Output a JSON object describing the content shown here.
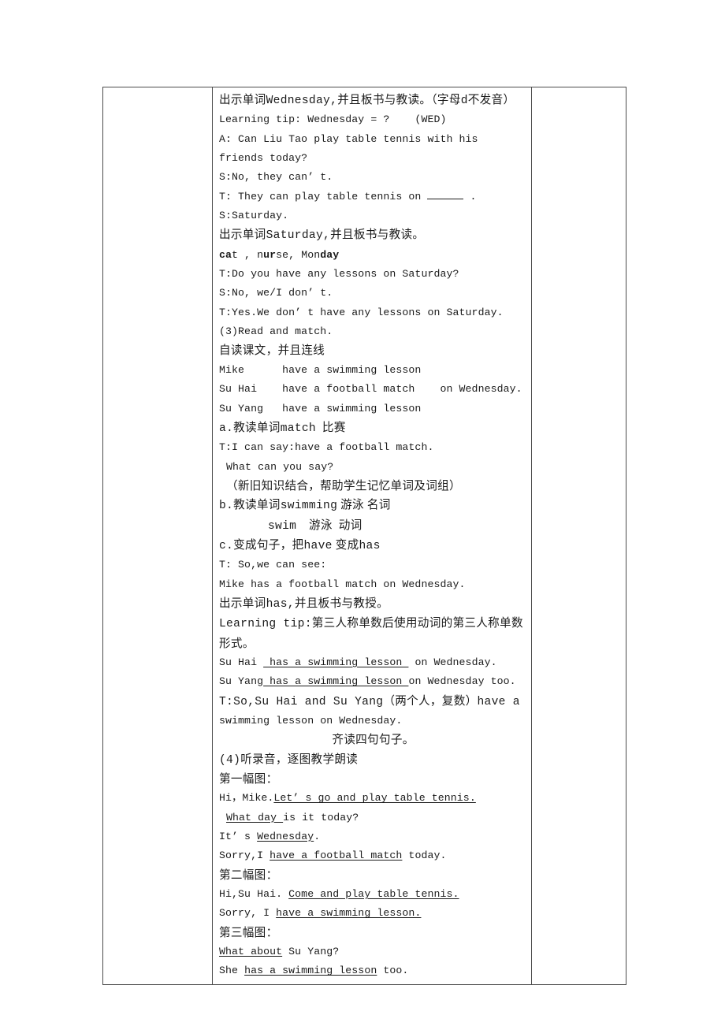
{
  "document": {
    "page_background": "#ffffff",
    "table": {
      "border_color": "#4c4c4c",
      "columns": [
        "",
        "",
        ""
      ],
      "left_cell_text": "",
      "right_cell_text": ""
    }
  },
  "lines": [
    {
      "id": "l01",
      "script": "cjk",
      "align": "left",
      "indent": 0,
      "segments": [
        {
          "t": "出示单词",
          "style": "cjk"
        },
        {
          "t": "Wednesday,",
          "style": "mono"
        },
        {
          "t": "并且板书与教读。（字母",
          "style": "cjk"
        },
        {
          "t": "d",
          "style": "mono"
        },
        {
          "t": "不发音）",
          "style": "cjk"
        }
      ]
    },
    {
      "id": "l02",
      "script": "mono",
      "align": "left",
      "indent": 0,
      "segments": [
        {
          "t": "Learning tip: Wednesday = ?    (WED)",
          "style": "mono"
        }
      ]
    },
    {
      "id": "l03",
      "script": "mono",
      "align": "left",
      "indent": 0,
      "segments": [
        {
          "t": "A: Can Liu Tao play table tennis with his friends today?",
          "style": "mono"
        }
      ]
    },
    {
      "id": "l04",
      "script": "mono",
      "align": "left",
      "indent": 0,
      "segments": [
        {
          "t": "S:No, they can’ t.",
          "style": "mono"
        }
      ]
    },
    {
      "id": "l05",
      "script": "mono",
      "align": "left",
      "indent": 0,
      "segments": [
        {
          "t": "T: They can play table tennis on ",
          "style": "mono"
        },
        {
          "t": "",
          "style": "blank"
        },
        {
          "t": " .",
          "style": "mono"
        }
      ]
    },
    {
      "id": "l06",
      "script": "mono",
      "align": "left",
      "indent": 0,
      "segments": [
        {
          "t": "S:Saturday.",
          "style": "mono"
        }
      ]
    },
    {
      "id": "l07",
      "script": "cjk",
      "align": "left",
      "indent": 0,
      "segments": [
        {
          "t": "出示单词",
          "style": "cjk"
        },
        {
          "t": "Saturday,",
          "style": "mono"
        },
        {
          "t": "并且板书与教读。",
          "style": "cjk"
        }
      ]
    },
    {
      "id": "l08",
      "script": "mono",
      "align": "left",
      "indent": 0,
      "segments": [
        {
          "t": "c",
          "style": "bold"
        },
        {
          "t": "a",
          "style": "bold"
        },
        {
          "t": "t , n",
          "style": "mono"
        },
        {
          "t": "ur",
          "style": "bold"
        },
        {
          "t": "se, Mon",
          "style": "mono"
        },
        {
          "t": "day",
          "style": "bold"
        }
      ]
    },
    {
      "id": "l09",
      "script": "mono",
      "align": "left",
      "indent": 0,
      "segments": [
        {
          "t": "T:Do you have any lessons on Saturday?",
          "style": "mono"
        }
      ]
    },
    {
      "id": "l10",
      "script": "mono",
      "align": "left",
      "indent": 0,
      "segments": [
        {
          "t": "S:No, we/I don’ t.",
          "style": "mono"
        }
      ]
    },
    {
      "id": "l11",
      "script": "mono",
      "align": "left",
      "indent": 0,
      "segments": [
        {
          "t": "T:Yes.We don’ t have any lessons on Saturday.",
          "style": "mono"
        }
      ]
    },
    {
      "id": "l12",
      "script": "mono",
      "align": "left",
      "indent": 0,
      "segments": [
        {
          "t": "(3)Read and match.",
          "style": "mono"
        }
      ]
    },
    {
      "id": "l13",
      "script": "cjk",
      "align": "left",
      "indent": 0,
      "segments": [
        {
          "t": "自读课文，并且连线",
          "style": "cjk"
        }
      ]
    },
    {
      "id": "l14",
      "script": "mono",
      "align": "left",
      "indent": 0,
      "segments": [
        {
          "t": "Mike      have a swimming lesson",
          "style": "mono"
        }
      ]
    },
    {
      "id": "l15",
      "script": "mono",
      "align": "left",
      "indent": 0,
      "segments": [
        {
          "t": "Su Hai    have a football match    on Wednesday.",
          "style": "mono"
        }
      ]
    },
    {
      "id": "l16",
      "script": "mono",
      "align": "left",
      "indent": 0,
      "segments": [
        {
          "t": "Su Yang   have a swimming lesson",
          "style": "mono"
        }
      ]
    },
    {
      "id": "l17",
      "script": "cjk",
      "align": "left",
      "indent": 0,
      "segments": [
        {
          "t": "a.",
          "style": "mono"
        },
        {
          "t": "教读单词",
          "style": "cjk"
        },
        {
          "t": "match",
          "style": "mono"
        },
        {
          "t": "  比赛",
          "style": "cjk"
        }
      ]
    },
    {
      "id": "l18",
      "script": "mono",
      "align": "left",
      "indent": 0,
      "segments": [
        {
          "t": "T:I can say:have a football match.",
          "style": "mono"
        }
      ]
    },
    {
      "id": "l19",
      "script": "mono",
      "align": "left",
      "indent": 1,
      "segments": [
        {
          "t": "What can you say?",
          "style": "mono"
        }
      ]
    },
    {
      "id": "l20",
      "script": "cjk",
      "align": "left",
      "indent": 1,
      "segments": [
        {
          "t": "（新旧知识结合，帮助学生记忆单词及词组）",
          "style": "cjk"
        }
      ]
    },
    {
      "id": "l21",
      "script": "cjk",
      "align": "left",
      "indent": 0,
      "segments": [
        {
          "t": "b.",
          "style": "mono"
        },
        {
          "t": "教读单词",
          "style": "cjk"
        },
        {
          "t": "swimming",
          "style": "mono"
        },
        {
          "t": " 游泳 名词",
          "style": "cjk"
        }
      ]
    },
    {
      "id": "l22",
      "script": "cjk",
      "align": "left",
      "indent": 2,
      "segments": [
        {
          "t": "swim",
          "style": "mono"
        },
        {
          "t": "    游泳  动词",
          "style": "cjk"
        }
      ]
    },
    {
      "id": "l23",
      "script": "cjk",
      "align": "left",
      "indent": 0,
      "segments": [
        {
          "t": "c.",
          "style": "mono"
        },
        {
          "t": "变成句子，把",
          "style": "cjk"
        },
        {
          "t": "have",
          "style": "mono"
        },
        {
          "t": " 变成",
          "style": "cjk"
        },
        {
          "t": "has",
          "style": "mono"
        }
      ]
    },
    {
      "id": "l24",
      "script": "mono",
      "align": "left",
      "indent": 0,
      "segments": [
        {
          "t": "T: So,we can see:",
          "style": "mono"
        }
      ]
    },
    {
      "id": "l25",
      "script": "mono",
      "align": "left",
      "indent": 0,
      "segments": [
        {
          "t": "Mike has a football match on Wednesday.",
          "style": "mono"
        }
      ]
    },
    {
      "id": "l26",
      "script": "cjk",
      "align": "left",
      "indent": 0,
      "segments": [
        {
          "t": "出示单词",
          "style": "cjk"
        },
        {
          "t": "has,",
          "style": "mono"
        },
        {
          "t": "并且板书与教授。",
          "style": "cjk"
        }
      ]
    },
    {
      "id": "l27",
      "script": "cjk",
      "align": "left",
      "indent": 0,
      "segments": [
        {
          "t": "Learning tip:",
          "style": "mono"
        },
        {
          "t": "第三人称单数后使用动词的第三人称单数形式。",
          "style": "cjk"
        }
      ]
    },
    {
      "id": "l28",
      "script": "mono",
      "align": "left",
      "indent": 0,
      "segments": [
        {
          "t": "Su Hai ",
          "style": "mono"
        },
        {
          "t": " has a swimming lesson ",
          "style": "underline"
        },
        {
          "t": " on Wednesday.",
          "style": "mono"
        }
      ]
    },
    {
      "id": "l29",
      "script": "mono",
      "align": "left",
      "indent": 0,
      "segments": [
        {
          "t": "Su Yang",
          "style": "mono"
        },
        {
          "t": " has a swimming lesson ",
          "style": "underline"
        },
        {
          "t": "on Wednesday too.",
          "style": "mono"
        }
      ]
    },
    {
      "id": "l30",
      "script": "cjk",
      "align": "left",
      "indent": 0,
      "segments": [
        {
          "t": "T:So,Su Hai and Su Yang",
          "style": "mono"
        },
        {
          "t": "（两个人，复数）",
          "style": "cjk"
        },
        {
          "t": "have a",
          "style": "mono"
        }
      ]
    },
    {
      "id": "l31",
      "script": "mono",
      "align": "left",
      "indent": 0,
      "segments": [
        {
          "t": "swimming lesson on Wednesday.",
          "style": "mono"
        }
      ]
    },
    {
      "id": "l32",
      "script": "cjk",
      "align": "center",
      "indent": 0,
      "segments": [
        {
          "t": "齐读四句句子。",
          "style": "cjk"
        }
      ]
    },
    {
      "id": "l33",
      "script": "cjk",
      "align": "left",
      "indent": 0,
      "segments": [
        {
          "t": "(4)",
          "style": "mono"
        },
        {
          "t": "听录音，逐图教学朗读",
          "style": "cjk"
        }
      ]
    },
    {
      "id": "l34",
      "script": "cjk",
      "align": "left",
      "indent": 0,
      "segments": [
        {
          "t": "第一幅图：",
          "style": "cjk"
        }
      ]
    },
    {
      "id": "l35",
      "script": "mono",
      "align": "left",
      "indent": 0,
      "segments": [
        {
          "t": "Hi，Mike.",
          "style": "mono"
        },
        {
          "t": "Let’ s go and play table tennis.",
          "style": "underline"
        }
      ]
    },
    {
      "id": "l36",
      "script": "mono",
      "align": "left",
      "indent": 1,
      "segments": [
        {
          "t": "What day ",
          "style": "underline"
        },
        {
          "t": "is it today?",
          "style": "mono"
        }
      ]
    },
    {
      "id": "l37",
      "script": "mono",
      "align": "left",
      "indent": 0,
      "segments": [
        {
          "t": "It’ s ",
          "style": "mono"
        },
        {
          "t": "Wednesday",
          "style": "underline"
        },
        {
          "t": ".",
          "style": "mono"
        }
      ]
    },
    {
      "id": "l38",
      "script": "mono",
      "align": "left",
      "indent": 0,
      "segments": [
        {
          "t": "Sorry,I ",
          "style": "mono"
        },
        {
          "t": "have a football match",
          "style": "underline"
        },
        {
          "t": " today.",
          "style": "mono"
        }
      ]
    },
    {
      "id": "l39",
      "script": "cjk",
      "align": "left",
      "indent": 0,
      "segments": [
        {
          "t": "第二幅图：",
          "style": "cjk"
        }
      ]
    },
    {
      "id": "l40",
      "script": "mono",
      "align": "left",
      "indent": 0,
      "segments": [
        {
          "t": "Hi,Su Hai. ",
          "style": "mono"
        },
        {
          "t": "Come and play table tennis.",
          "style": "underline"
        }
      ]
    },
    {
      "id": "l41",
      "script": "mono",
      "align": "left",
      "indent": 0,
      "segments": [
        {
          "t": "Sorry, I ",
          "style": "mono"
        },
        {
          "t": "have a swimming lesson.",
          "style": "underline"
        }
      ]
    },
    {
      "id": "l42",
      "script": "cjk",
      "align": "left",
      "indent": 0,
      "segments": [
        {
          "t": "第三幅图：",
          "style": "cjk"
        }
      ]
    },
    {
      "id": "l43",
      "script": "mono",
      "align": "left",
      "indent": 0,
      "segments": [
        {
          "t": "What about",
          "style": "underline"
        },
        {
          "t": " Su Yang?",
          "style": "mono"
        }
      ]
    },
    {
      "id": "l44",
      "script": "mono",
      "align": "left",
      "indent": 0,
      "segments": [
        {
          "t": "She ",
          "style": "mono"
        },
        {
          "t": "has a swimming lesson",
          "style": "underline"
        },
        {
          "t": " too.",
          "style": "mono"
        }
      ]
    }
  ]
}
